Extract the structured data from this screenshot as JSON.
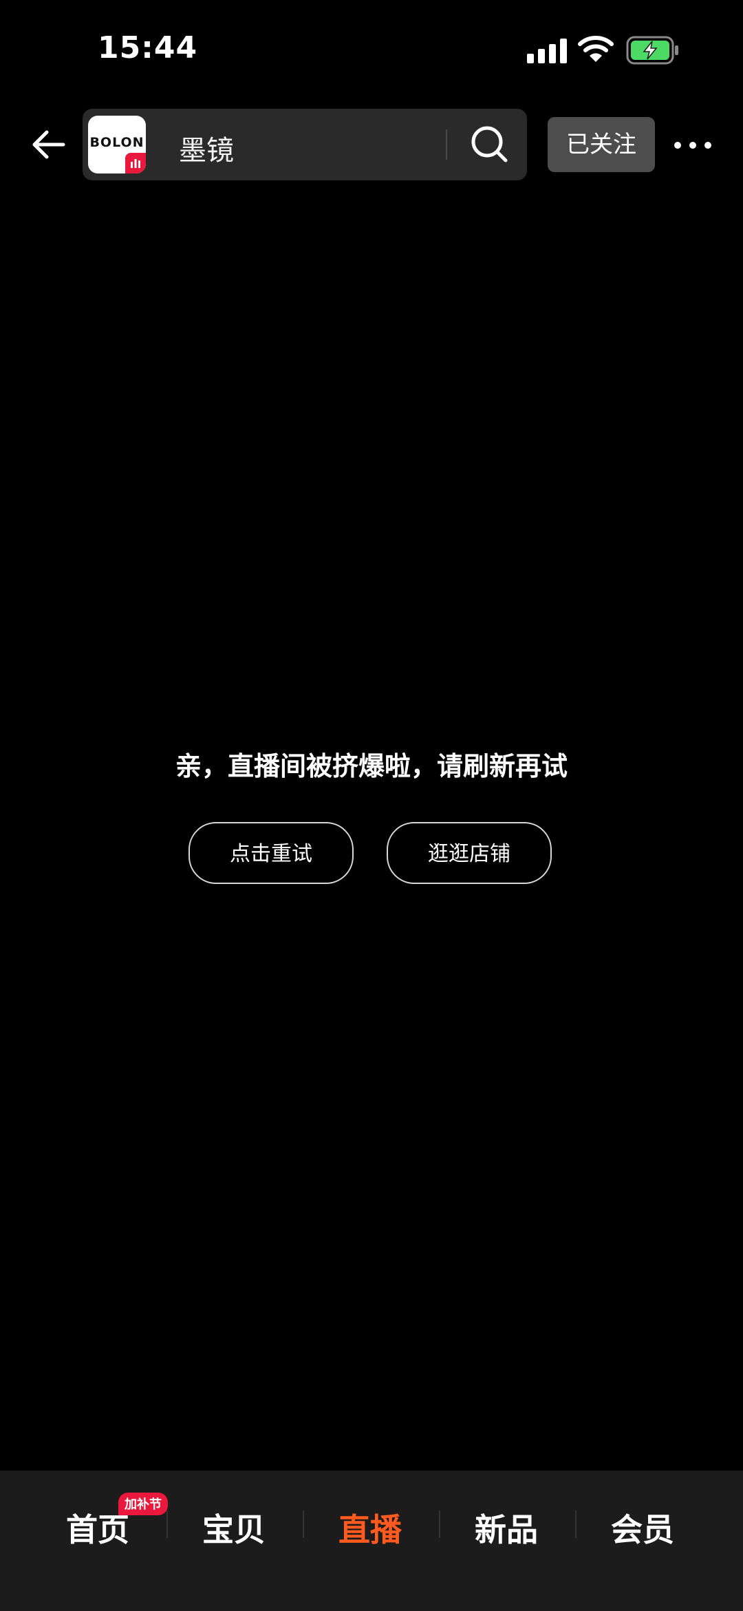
{
  "status_bar": {
    "time": "15:44"
  },
  "header": {
    "back_icon": "arrow-left-icon",
    "shop_logo_text": "BOLON",
    "shop_name": "墨镜",
    "search_icon": "search-icon",
    "follow_label": "已关注",
    "more_icon": "more-horizontal-icon"
  },
  "main": {
    "error_message": "亲，直播间被挤爆啦，请刷新再试",
    "retry_label": "点击重试",
    "visit_shop_label": "逛逛店铺"
  },
  "bottom_nav": {
    "items": [
      {
        "label": "首页",
        "badge": "加补节"
      },
      {
        "label": "宝贝"
      },
      {
        "label": "直播",
        "active": true
      },
      {
        "label": "新品"
      },
      {
        "label": "会员"
      }
    ]
  },
  "colors": {
    "background": "#000000",
    "accent": "#ff5a1f",
    "badge": "#e8193c",
    "battery": "#4cd964"
  }
}
